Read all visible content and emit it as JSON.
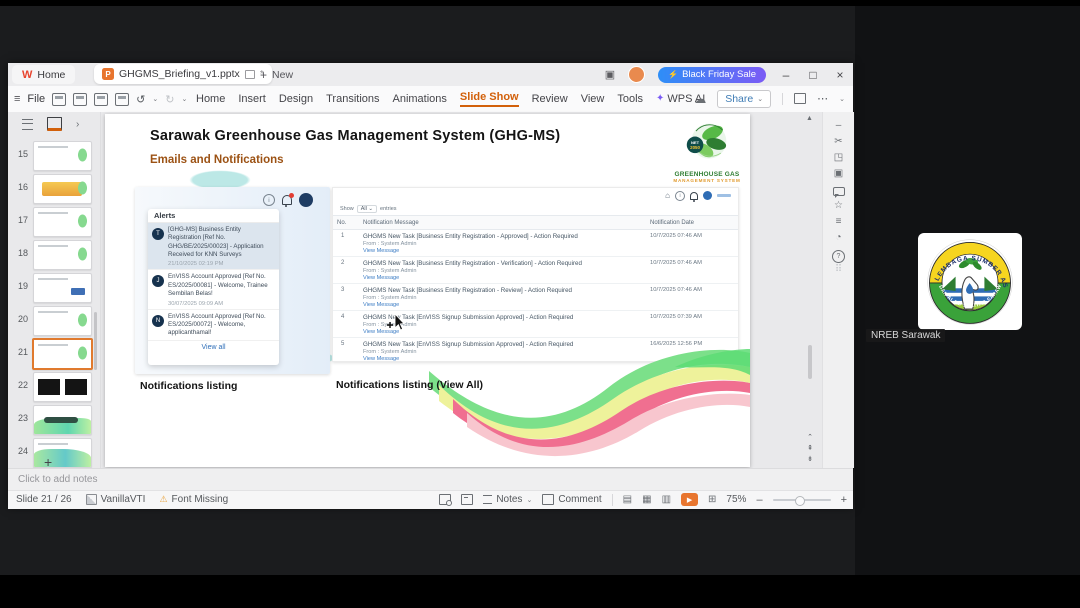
{
  "colors": {
    "accent_orange": "#d2600a",
    "promo_gradient_start": "#2e8ef7",
    "promo_gradient_end": "#7b5bf5",
    "play_button_orange": "#e8752e",
    "link_blue": "#2f6fb8",
    "logo_green": "#2e7d32",
    "logo_orange": "#e09a2d",
    "selected_alert_bg": "#dce5ee"
  },
  "icons": {
    "hamburger": "≡",
    "minimize": "–",
    "maximize": "□",
    "close": "×",
    "plus": "+",
    "chevron_down": "⌄",
    "chevron_right": "›",
    "undo": "↺",
    "redo": "↻",
    "lightning": "⚡",
    "sparkle": "✦",
    "cloud": "☁",
    "dots": "⋯",
    "warning": "⚠",
    "star": "☆",
    "scissors": "✂",
    "clock": "◔",
    "grid_dots": "⠿",
    "home": "⌂",
    "play": "▶",
    "stack": "▣",
    "asterisk": "*",
    "info": "i",
    "question": "?",
    "dash": "–",
    "crop": "◳",
    "adjust": "≡",
    "scroll_up": "▲",
    "chevron_up": "⌃",
    "page_up": "⇞",
    "page_down": "⇟",
    "view_normal": "▤",
    "view_sorter": "▦",
    "view_read": "▥",
    "fullscreen": "⊞"
  },
  "titlebar": {
    "home_tab": "Home",
    "doc_tab": "GHGMS_Briefing_v1.pptx",
    "new_label": "New",
    "doc_badge": "P",
    "wps_logo": "W",
    "promo": "Black Friday Sale"
  },
  "menubar": {
    "file": "File",
    "menus": [
      "Home",
      "Insert",
      "Design",
      "Transitions",
      "Animations",
      "Slide Show",
      "Review",
      "View",
      "Tools"
    ],
    "active_menu": "Slide Show",
    "wps_ai": "WPS AI",
    "share": "Share"
  },
  "slide_panel": {
    "slides": [
      "15",
      "16",
      "17",
      "18",
      "19",
      "20",
      "21",
      "22",
      "23",
      "24"
    ],
    "add": "+"
  },
  "slide": {
    "title": "Sarawak Greenhouse Gas Management System (GHG-MS)",
    "subtitle": "Emails and Notifications",
    "logo": {
      "badge_top": "NET",
      "badge_bottom": "2050",
      "line1": "GREENHOUSE GAS",
      "line2": "MANAGEMENT SYSTEM"
    },
    "alerts_panel": {
      "header": "Alerts",
      "items": [
        {
          "initial": "T",
          "text": "[GHG-MS] Business Entity Registration [Ref No. GHG/BE/2025/00023] - Application Received for KNN Surveys",
          "time": "21/10/2025 02:19 PM"
        },
        {
          "initial": "J",
          "text": "EnVISS Account Approved [Ref No. ES/2025/00081] - Welcome, Trainee Sembilan Belas!",
          "time": "30/07/2025 09:09 AM"
        },
        {
          "initial": "N",
          "text": "EnVISS Account Approved [Ref No. ES/2025/00072] - Welcome, applicanthamal!",
          "time": ""
        }
      ],
      "view_all": "View all"
    },
    "table_page": {
      "show_label": "Show",
      "show_value": "All ⌄",
      "entries_label": "entries",
      "headers": [
        "No.",
        "Notification Message",
        "Notification Date"
      ],
      "rows": [
        {
          "no": "1",
          "message": "GHGMS New Task [Business Entity Registration - Approved] - Action Required",
          "from": "From : System Admin",
          "link": "View Message",
          "date": "10/7/2025 07:46 AM"
        },
        {
          "no": "2",
          "message": "GHGMS New Task [Business Entity Registration - Verification] - Action Required",
          "from": "From : System Admin",
          "link": "View Message",
          "date": "10/7/2025 07:46 AM"
        },
        {
          "no": "3",
          "message": "GHGMS New Task [Business Entity Registration - Review] - Action Required",
          "from": "From : System Admin",
          "link": "View Message",
          "date": "10/7/2025 07:46 AM"
        },
        {
          "no": "4",
          "message": "GHGMS New Task [EnVISS Signup Submission Approved] - Action Required",
          "from": "From : System Admin",
          "link": "View Message",
          "date": "10/7/2025 07:39 AM"
        },
        {
          "no": "5",
          "message": "GHGMS New Task [EnVISS Signup Submission Approved] - Action Required",
          "from": "From : System Admin",
          "link": "View Message",
          "date": "16/6/2025 12:56 PM"
        }
      ]
    },
    "caption_left": "Notifications listing",
    "caption_right": "Notifications listing (View All)"
  },
  "notes_bar": {
    "placeholder": "Click to add notes"
  },
  "status_bar": {
    "slide_indicator": "Slide 21 / 26",
    "theme": "VanillaVTI",
    "font_missing": "Font Missing",
    "notes": "Notes",
    "comment": "Comment",
    "zoom": "75%"
  },
  "meeting": {
    "participant_label": "NREB Sarawak",
    "logo_arc_top": "LEMBAGA SUMBER ASLI",
    "logo_arc_bottom": "DAN ALAM SEKITAR SARAWAK"
  }
}
